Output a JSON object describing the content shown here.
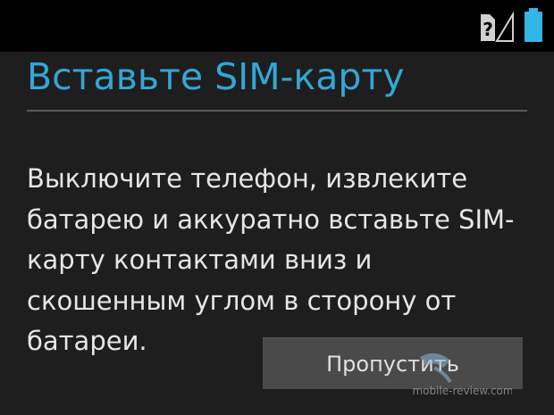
{
  "status_bar": {
    "icons": [
      "sim-missing-icon",
      "battery-full-icon"
    ],
    "icon_color": "#33b5e5",
    "sim_icon_color": "#d0d0d0"
  },
  "setup": {
    "title": "Вставьте SIM-карту",
    "title_color": "#33a7d6",
    "message": "Выключите телефон, извлеките батарею и аккуратно вставьте SIM-карту контактами вниз и скошенным углом в сторону от батареи.",
    "skip_label": "Пропустить"
  },
  "watermark": {
    "text": "mobile-review.com"
  }
}
